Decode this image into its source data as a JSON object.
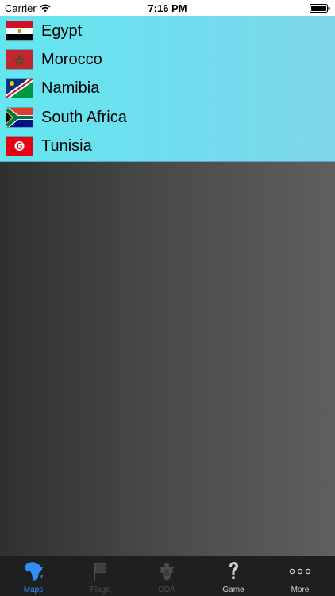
{
  "status_bar": {
    "carrier": "Carrier",
    "time": "7:16 PM"
  },
  "countries": [
    {
      "name": "Egypt",
      "flag_icon": "egypt-flag-icon"
    },
    {
      "name": "Morocco",
      "flag_icon": "morocco-flag-icon"
    },
    {
      "name": "Namibia",
      "flag_icon": "namibia-flag-icon"
    },
    {
      "name": "South Africa",
      "flag_icon": "south-africa-flag-icon"
    },
    {
      "name": "Tunisia",
      "flag_icon": "tunisia-flag-icon"
    }
  ],
  "tab_bar": {
    "tabs": [
      {
        "label": "Maps",
        "icon": "africa-map-icon",
        "state": "selected"
      },
      {
        "label": "Flags",
        "icon": "flag-icon",
        "state": "disabled"
      },
      {
        "label": "COA",
        "icon": "coat-of-arms-icon",
        "state": "disabled"
      },
      {
        "label": "Game",
        "icon": "question-mark-icon",
        "state": "normal"
      },
      {
        "label": "More",
        "icon": "more-dots-icon",
        "state": "normal"
      }
    ]
  },
  "colors": {
    "list_background": "#6ee0ee",
    "tab_active": "#2f8df5",
    "tab_bar_background": "#1e1f1f"
  }
}
